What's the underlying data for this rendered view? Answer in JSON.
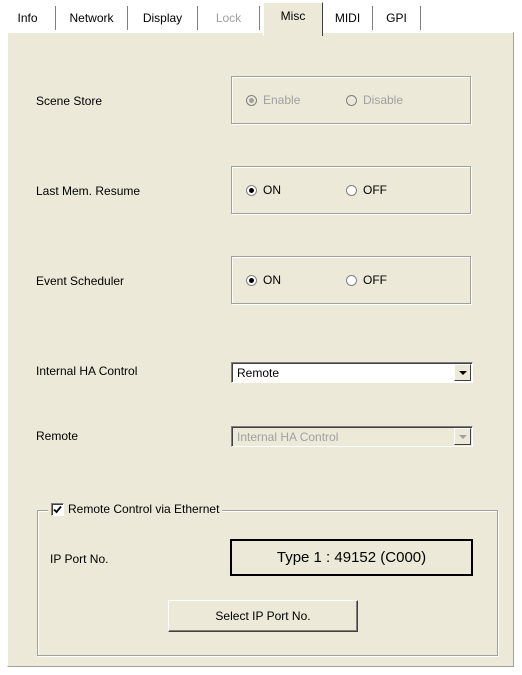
{
  "tabs": [
    {
      "label": "Info",
      "state": "normal"
    },
    {
      "label": "Network",
      "state": "normal"
    },
    {
      "label": "Display",
      "state": "normal"
    },
    {
      "label": "Lock",
      "state": "disabled"
    },
    {
      "label": "Misc",
      "state": "active"
    },
    {
      "label": "MIDI",
      "state": "normal"
    },
    {
      "label": "GPI",
      "state": "normal"
    }
  ],
  "scene_store": {
    "label": "Scene Store",
    "enabled": false,
    "options": [
      "Enable",
      "Disable"
    ],
    "selected": "Enable"
  },
  "last_mem_resume": {
    "label": "Last Mem. Resume",
    "options": [
      "ON",
      "OFF"
    ],
    "selected": "ON"
  },
  "event_scheduler": {
    "label": "Event Scheduler",
    "options": [
      "ON",
      "OFF"
    ],
    "selected": "ON"
  },
  "internal_ha_control": {
    "label": "Internal HA Control",
    "value": "Remote"
  },
  "remote": {
    "label": "Remote",
    "value": "Internal HA Control",
    "enabled": false
  },
  "remote_ethernet": {
    "checkbox_label": "Remote Control via Ethernet",
    "checked": true,
    "ip_port_label": "IP Port No.",
    "ip_port_value": "Type 1 : 49152 (C000)",
    "select_button_label": "Select IP Port No."
  },
  "colors": {
    "panel_bg": "#ece9d8",
    "disabled_text": "#a0a0a0"
  }
}
